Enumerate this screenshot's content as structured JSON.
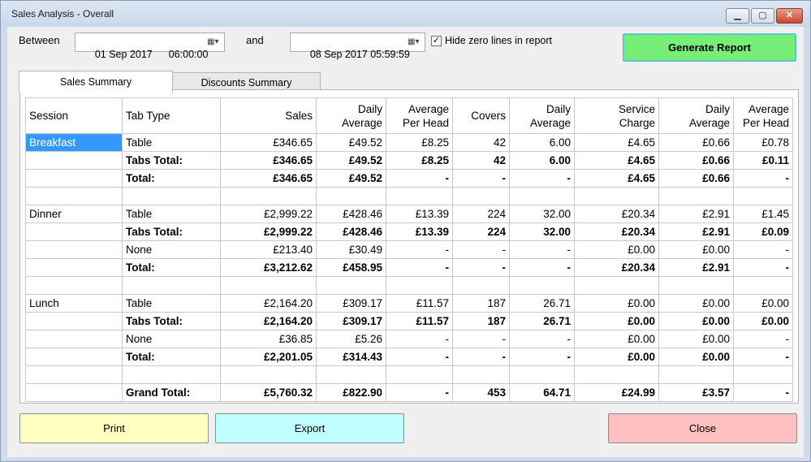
{
  "window": {
    "title": "Sales Analysis - Overall"
  },
  "filters": {
    "between_label": "Between",
    "from_date": "01 Sep 2017",
    "from_time": "06:00:00",
    "and_label": "and",
    "to_datetime": "08 Sep 2017 05:59:59",
    "hide_zero_label": "Hide zero lines in report",
    "hide_zero_checked": true
  },
  "buttons": {
    "generate": "Generate Report",
    "print": "Print",
    "export": "Export",
    "close": "Close"
  },
  "tabs": [
    {
      "label": "Sales Summary",
      "active": true
    },
    {
      "label": "Discounts Summary",
      "active": false
    }
  ],
  "table": {
    "headers": {
      "session": "Session",
      "tab_type": "Tab Type",
      "sales": "Sales",
      "daily_avg1_a": "Daily",
      "daily_avg1_b": "Average",
      "avg_head1_a": "Average",
      "avg_head1_b": "Per Head",
      "covers": "Covers",
      "daily_avg2_a": "Daily",
      "daily_avg2_b": "Average",
      "service_a": "Service",
      "service_b": "Charge",
      "daily_avg3_a": "Daily",
      "daily_avg3_b": "Average",
      "avg_head2_a": "Average",
      "avg_head2_b": "Per Head"
    },
    "rows": [
      {
        "c": [
          "Breakfast",
          "Table",
          "£346.65",
          "£49.52",
          "£8.25",
          "42",
          "6.00",
          "£4.65",
          "£0.66",
          "£0.78"
        ]
      },
      {
        "c": [
          "",
          "Tabs Total:",
          "£346.65",
          "£49.52",
          "£8.25",
          "42",
          "6.00",
          "£4.65",
          "£0.66",
          "£0.11"
        ]
      },
      {
        "c": [
          "",
          "Total:",
          "£346.65",
          "£49.52",
          "-",
          "-",
          "-",
          "£4.65",
          "£0.66",
          "-"
        ]
      },
      {
        "c": [
          "",
          "",
          "",
          "",
          "",
          "",
          "",
          "",
          "",
          ""
        ]
      },
      {
        "c": [
          "Dinner",
          "Table",
          "£2,999.22",
          "£428.46",
          "£13.39",
          "224",
          "32.00",
          "£20.34",
          "£2.91",
          "£1.45"
        ]
      },
      {
        "c": [
          "",
          "Tabs Total:",
          "£2,999.22",
          "£428.46",
          "£13.39",
          "224",
          "32.00",
          "£20.34",
          "£2.91",
          "£0.09"
        ]
      },
      {
        "c": [
          "",
          "None",
          "£213.40",
          "£30.49",
          "-",
          "-",
          "-",
          "£0.00",
          "£0.00",
          "-"
        ]
      },
      {
        "c": [
          "",
          "Total:",
          "£3,212.62",
          "£458.95",
          "-",
          "-",
          "-",
          "£20.34",
          "£2.91",
          "-"
        ]
      },
      {
        "c": [
          "",
          "",
          "",
          "",
          "",
          "",
          "",
          "",
          "",
          ""
        ]
      },
      {
        "c": [
          "Lunch",
          "Table",
          "£2,164.20",
          "£309.17",
          "£11.57",
          "187",
          "26.71",
          "£0.00",
          "£0.00",
          "£0.00"
        ]
      },
      {
        "c": [
          "",
          "Tabs Total:",
          "£2,164.20",
          "£309.17",
          "£11.57",
          "187",
          "26.71",
          "£0.00",
          "£0.00",
          "£0.00"
        ]
      },
      {
        "c": [
          "",
          "None",
          "£36.85",
          "£5.26",
          "-",
          "-",
          "-",
          "£0.00",
          "£0.00",
          "-"
        ]
      },
      {
        "c": [
          "",
          "Total:",
          "£2,201.05",
          "£314.43",
          "-",
          "-",
          "-",
          "£0.00",
          "£0.00",
          "-"
        ]
      },
      {
        "c": [
          "",
          "",
          "",
          "",
          "",
          "",
          "",
          "",
          "",
          ""
        ]
      },
      {
        "c": [
          "",
          "Grand Total:",
          "£5,760.32",
          "£822.90",
          "-",
          "453",
          "64.71",
          "£24.99",
          "£3.57",
          "-"
        ]
      }
    ]
  },
  "colors": {
    "generate_bg": "#77ee77",
    "print_bg": "#ffffc0",
    "export_bg": "#c0ffff",
    "close_bg": "#ffc0c0",
    "selection": "#3399ff"
  }
}
